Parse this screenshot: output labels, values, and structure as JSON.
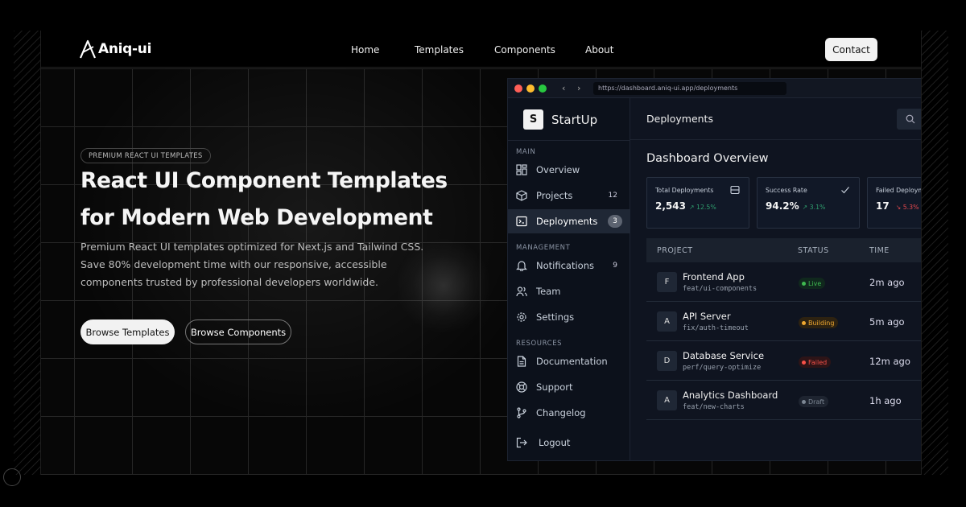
{
  "nav": {
    "logo": "Aniq-ui",
    "links": [
      "Home",
      "Templates",
      "Components",
      "About"
    ],
    "contact": "Contact"
  },
  "hero": {
    "badge": "PREMIUM REACT UI TEMPLATES",
    "title_line1": "React UI Component Templates",
    "title_line2": "for Modern Web Development",
    "subtitle": "Premium React UI templates optimized for Next.js and Tailwind CSS. Save 80% development time with our responsive, accessible components trusted by professional developers worldwide.",
    "btn_primary": "Browse Templates",
    "btn_secondary": "Browse Components"
  },
  "browser": {
    "url": "https://dashboard.aniq-ui.app/deployments",
    "dot_colors": [
      "#ff5f57",
      "#febc2e",
      "#28c840"
    ]
  },
  "sidebar": {
    "brand_letter": "S",
    "brand_name": "StartUp",
    "sections": [
      "MAIN",
      "MANAGEMENT",
      "RESOURCES"
    ],
    "items": [
      {
        "label": "Overview",
        "icon": "grid-icon",
        "count": ""
      },
      {
        "label": "Projects",
        "icon": "box-icon",
        "count": "12"
      },
      {
        "label": "Deployments",
        "icon": "terminal-icon",
        "count": "3",
        "active": true
      },
      {
        "label": "Notifications",
        "icon": "bell-icon",
        "count": "9"
      },
      {
        "label": "Team",
        "icon": "users-icon",
        "count": ""
      },
      {
        "label": "Settings",
        "icon": "gear-icon",
        "count": ""
      },
      {
        "label": "Documentation",
        "icon": "document-icon",
        "count": ""
      },
      {
        "label": "Support",
        "icon": "lifebuoy-icon",
        "count": ""
      },
      {
        "label": "Changelog",
        "icon": "git-branch-icon",
        "count": ""
      }
    ],
    "logout": "Logout"
  },
  "main": {
    "header_title": "Deployments",
    "overview_title": "Dashboard Overview",
    "cards": [
      {
        "title": "Total Deployments",
        "value": "2,543",
        "delta": "↗ 12.5%",
        "delta_color": "#2f9e6e",
        "icon": "server-icon"
      },
      {
        "title": "Success Rate",
        "value": "94.2%",
        "delta": "↗ 3.1%",
        "delta_color": "#2f9e6e",
        "icon": "check-icon"
      },
      {
        "title": "Failed Deployments",
        "value": "17",
        "delta": "↘ 5.3%",
        "delta_color": "#e5484d",
        "icon": "x-icon"
      }
    ],
    "table": {
      "headers": [
        "PROJECT",
        "STATUS",
        "TIME"
      ],
      "rows": [
        {
          "initial": "F",
          "name": "Frontend App",
          "branch": "feat/ui-components",
          "status": "Live",
          "status_color": "#3fb950",
          "status_bg": "#10281d",
          "time": "2m ago"
        },
        {
          "initial": "A",
          "name": "API Server",
          "branch": "fix/auth-timeout",
          "status": "Building",
          "status_color": "#f0a830",
          "status_bg": "#2d2211",
          "time": "5m ago"
        },
        {
          "initial": "D",
          "name": "Database Service",
          "branch": "perf/query-optimize",
          "status": "Failed",
          "status_color": "#f85149",
          "status_bg": "#2d1417",
          "time": "12m ago"
        },
        {
          "initial": "A",
          "name": "Analytics Dashboard",
          "branch": "feat/new-charts",
          "status": "Draft",
          "status_color": "#7d8794",
          "status_bg": "#1e2430",
          "time": "1h ago"
        }
      ]
    }
  }
}
